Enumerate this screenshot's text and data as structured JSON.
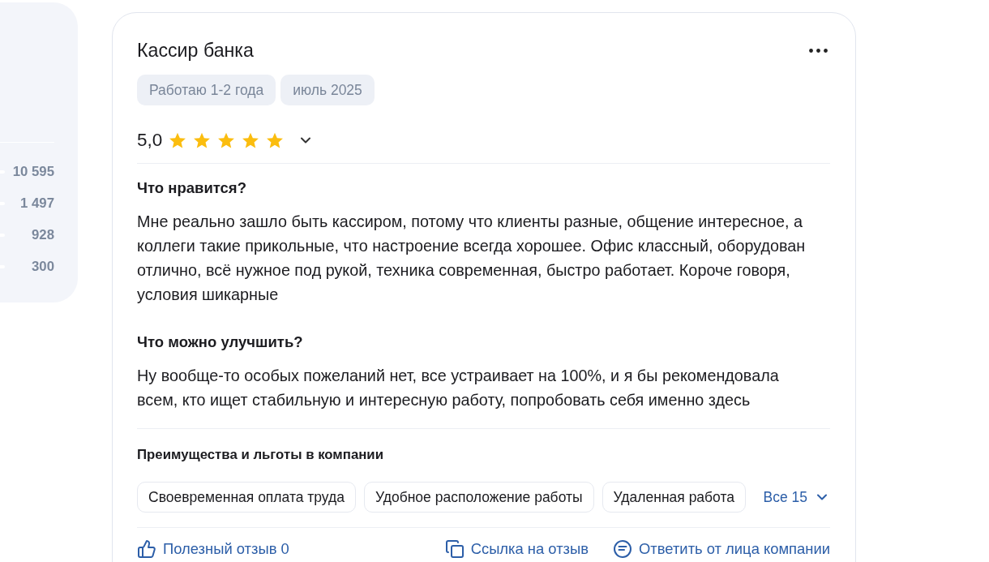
{
  "rating_sidebar": {
    "rows": [
      {
        "count": "10 595"
      },
      {
        "count": "1 497"
      },
      {
        "count": "928"
      },
      {
        "count": "300"
      }
    ]
  },
  "review": {
    "title": "Кассир банка",
    "tags": [
      "Работаю 1-2 года",
      "июль 2025"
    ],
    "rating": {
      "score": "5,0",
      "stars": 5
    },
    "sections": [
      {
        "heading": "Что нравится?",
        "text": "Мне реально зашло быть кассиром, потому что клиенты разные, общение интересное, а коллеги такие прикольные, что настроение всегда хорошее. Офис классный, оборудован отлично, всё нужное под рукой, техника современная, быстро работает. Короче говоря, условия шикарные"
      },
      {
        "heading": "Что можно улучшить?",
        "text": "Ну вообще-то особых пожеланий нет, все устраивает на 100%, и я бы рекомендовала всем, кто ищет стабильную и интересную работу, попробовать себя именно здесь"
      }
    ],
    "benefits": {
      "heading": "Преимущества и льготы в компании",
      "chips": [
        "Своевременная оплата труда",
        "Удобное расположение работы",
        "Удаленная работа"
      ],
      "more": "Все 15"
    },
    "actions": [
      {
        "kind": "helpful",
        "label": "Полезный отзыв 0"
      },
      {
        "kind": "link",
        "label": "Ссылка на отзыв"
      },
      {
        "kind": "reply",
        "label": "Ответить от лица компании"
      }
    ]
  }
}
